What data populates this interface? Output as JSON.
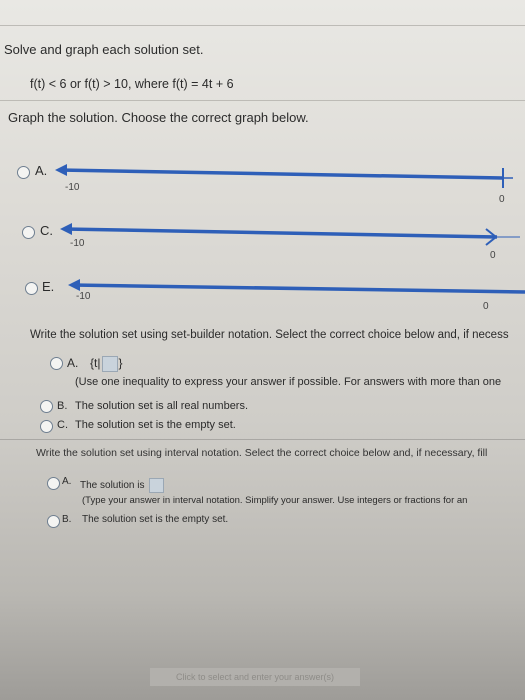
{
  "header": {
    "title": "Solve and graph each solution set.",
    "equation": "f(t) < 6 or f(t) > 10, where f(t) = 4t + 6"
  },
  "graph_question": {
    "prompt": "Graph the solution. Choose the correct graph below.",
    "options": [
      {
        "letter": "A.",
        "left_tick": "-10",
        "right_tick": "0"
      },
      {
        "letter": "C.",
        "left_tick": "-10",
        "right_tick": "0"
      },
      {
        "letter": "E.",
        "left_tick": "-10",
        "right_tick": "0"
      }
    ]
  },
  "set_builder_question": {
    "prompt": "Write the solution set using set-builder notation. Select the correct choice below and, if necess",
    "option_a_letter": "A.",
    "option_a_prefix": "{t|",
    "option_a_suffix": "}",
    "option_a_hint": "(Use one inequality to express your answer if possible. For answers with more than one",
    "option_b_letter": "B.",
    "option_b_text": "The solution set is all real numbers.",
    "option_c_letter": "C.",
    "option_c_text": "The solution set is the empty set."
  },
  "interval_question": {
    "prompt": "Write the solution set using interval notation. Select the correct choice below and, if necessary, fill",
    "option_a_letter": "A.",
    "option_a_text": "The solution is",
    "option_a_hint": "(Type your answer in interval notation. Simplify your answer. Use integers or fractions for an",
    "option_b_letter": "B.",
    "option_b_text": "The solution set is the empty set."
  },
  "footer": {
    "text": "Click to select and enter your answer(s)"
  },
  "colors": {
    "line": "#2e5fb8",
    "radio_border": "#6f7f90"
  }
}
